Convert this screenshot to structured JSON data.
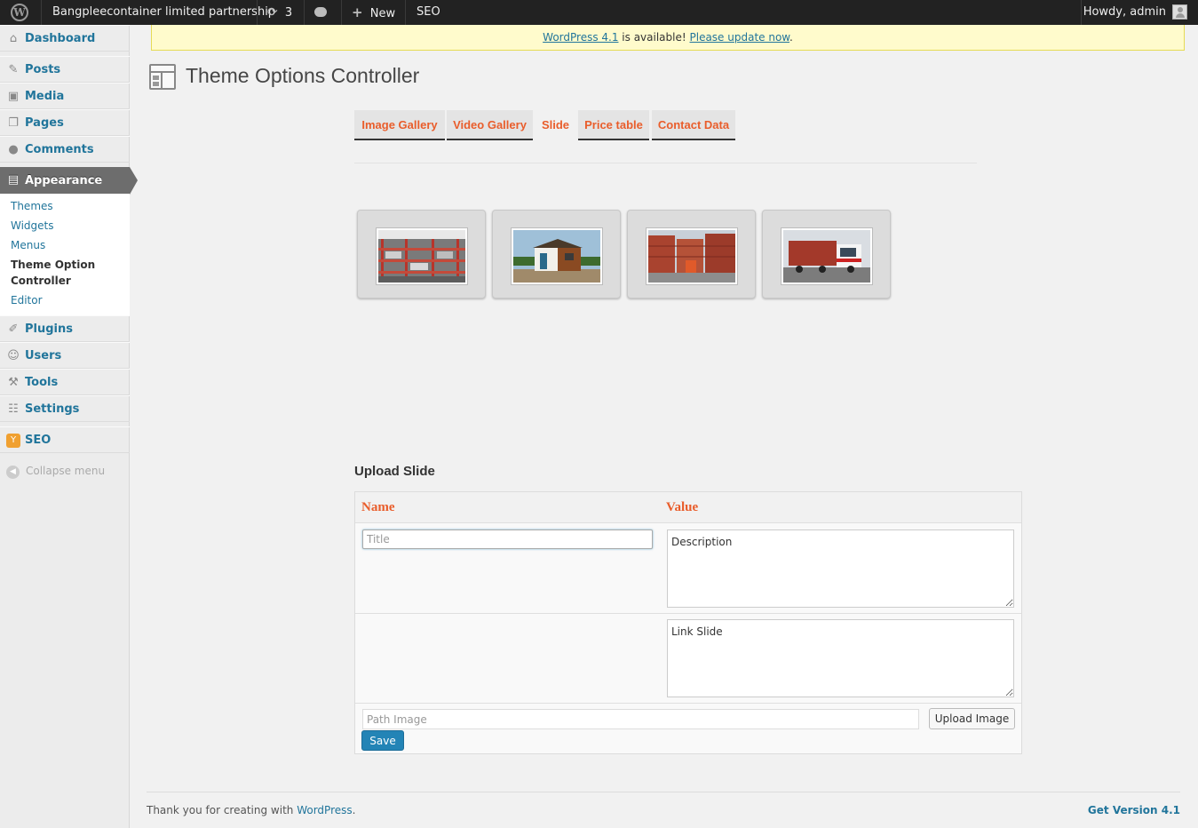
{
  "adminbar": {
    "site_name": "Bangpleecontainer limited partnership",
    "updates_count": "3",
    "new_label": "New",
    "seo_label": "SEO",
    "howdy": "Howdy, admin"
  },
  "sidebar": {
    "items": [
      {
        "label": "Dashboard",
        "icon": "dashboard-icon"
      },
      {
        "label": "Posts",
        "icon": "pushpin-icon"
      },
      {
        "label": "Media",
        "icon": "media-icon"
      },
      {
        "label": "Pages",
        "icon": "pages-icon"
      },
      {
        "label": "Comments",
        "icon": "comment-icon"
      },
      {
        "label": "Appearance",
        "icon": "appearance-icon"
      },
      {
        "label": "Plugins",
        "icon": "plug-icon"
      },
      {
        "label": "Users",
        "icon": "users-icon"
      },
      {
        "label": "Tools",
        "icon": "tools-icon"
      },
      {
        "label": "Settings",
        "icon": "settings-icon"
      },
      {
        "label": "SEO",
        "icon": "seo-icon"
      }
    ],
    "submenu": [
      "Themes",
      "Widgets",
      "Menus",
      "Theme Option",
      "Controller",
      "Editor"
    ],
    "collapse_label": "Collapse menu"
  },
  "nag": {
    "link1": "WordPress 4.1",
    "middle": " is available! ",
    "link2": "Please update now",
    "end": "."
  },
  "page_title": "Theme Options Controller",
  "tabs": [
    "Image Gallery",
    "Video Gallery",
    "Slide",
    "Price table",
    "Contact Data"
  ],
  "active_tab": "Slide",
  "upload": {
    "heading": "Upload Slide",
    "col_name": "Name",
    "col_value": "Value",
    "title_placeholder": "Title",
    "description_value": "Description",
    "link_value": "Link Slide",
    "path_placeholder": "Path Image",
    "upload_button": "Upload Image",
    "save_button": "Save"
  },
  "footer": {
    "thanks_prefix": "Thank you for creating with ",
    "thanks_link": "WordPress",
    "thanks_suffix": ".",
    "version": "Get Version 4.1"
  },
  "colors": {
    "accent": "#e95d2b",
    "link": "#21759b",
    "save": "#2384b6"
  }
}
